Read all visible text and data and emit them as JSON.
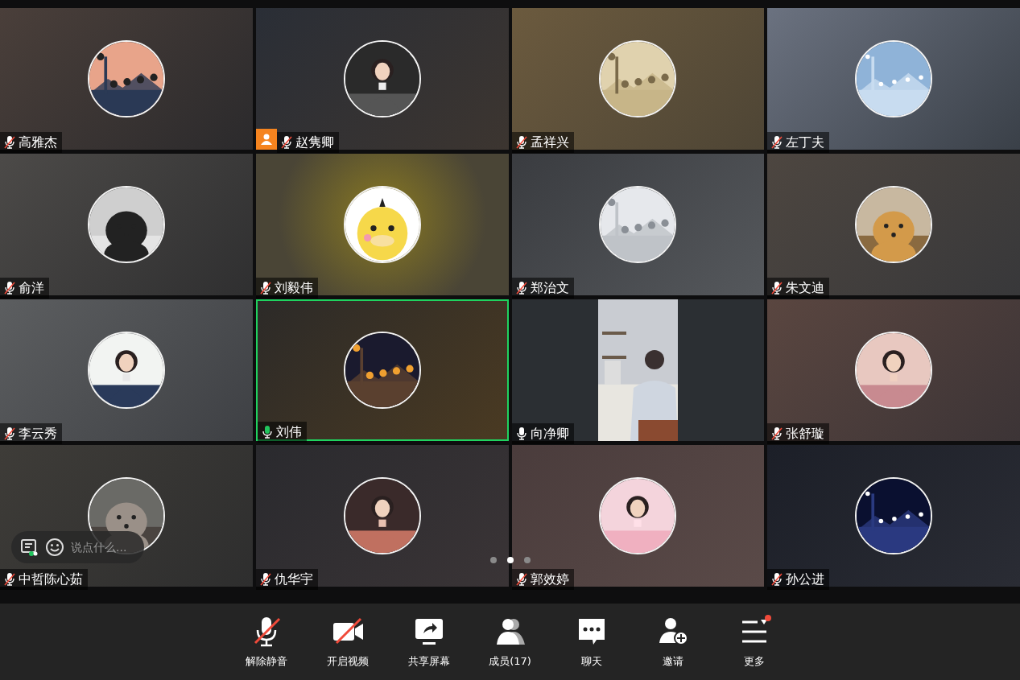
{
  "participants": [
    {
      "name": "高雅杰",
      "muted": true,
      "speaking": false,
      "kind": "avatar",
      "host": false
    },
    {
      "name": "赵隽卿",
      "muted": true,
      "speaking": false,
      "kind": "avatar",
      "host": true
    },
    {
      "name": "孟祥兴",
      "muted": true,
      "speaking": false,
      "kind": "avatar",
      "host": false
    },
    {
      "name": "左丁夫",
      "muted": true,
      "speaking": false,
      "kind": "avatar",
      "host": false
    },
    {
      "name": "俞洋",
      "muted": true,
      "speaking": false,
      "kind": "avatar",
      "host": false
    },
    {
      "name": "刘毅伟",
      "muted": true,
      "speaking": false,
      "kind": "avatar",
      "host": false
    },
    {
      "name": "郑治文",
      "muted": true,
      "speaking": false,
      "kind": "avatar",
      "host": false
    },
    {
      "name": "朱文迪",
      "muted": true,
      "speaking": false,
      "kind": "avatar",
      "host": false
    },
    {
      "name": "李云秀",
      "muted": true,
      "speaking": false,
      "kind": "avatar",
      "host": false
    },
    {
      "name": "刘伟",
      "muted": false,
      "speaking": true,
      "kind": "avatar",
      "host": false
    },
    {
      "name": "向净卿",
      "muted": false,
      "speaking": false,
      "kind": "video",
      "host": false
    },
    {
      "name": "张舒璇",
      "muted": true,
      "speaking": false,
      "kind": "avatar",
      "host": false
    },
    {
      "name": "中哲陈心茹",
      "muted": true,
      "speaking": false,
      "kind": "avatar",
      "host": false
    },
    {
      "name": "仇华宇",
      "muted": true,
      "speaking": false,
      "kind": "avatar",
      "host": false
    },
    {
      "name": "郭效婷",
      "muted": true,
      "speaking": false,
      "kind": "avatar",
      "host": false
    },
    {
      "name": "孙公进",
      "muted": true,
      "speaking": false,
      "kind": "avatar",
      "host": false
    }
  ],
  "chat_bar": {
    "placeholder": "说点什么..."
  },
  "page_dots": [
    {
      "selected": false
    },
    {
      "selected": true
    },
    {
      "selected": false
    }
  ],
  "toolbar": [
    {
      "label": "解除静音",
      "kind": "mic",
      "off": true
    },
    {
      "label": "开启视频",
      "kind": "camera",
      "off": true
    },
    {
      "label": "共享屏幕",
      "kind": "share"
    },
    {
      "label": "成员(17)",
      "kind": "members"
    },
    {
      "label": "聊天",
      "kind": "chat"
    },
    {
      "label": "邀请",
      "kind": "invite"
    },
    {
      "label": "更多",
      "kind": "more",
      "badge": true
    }
  ]
}
